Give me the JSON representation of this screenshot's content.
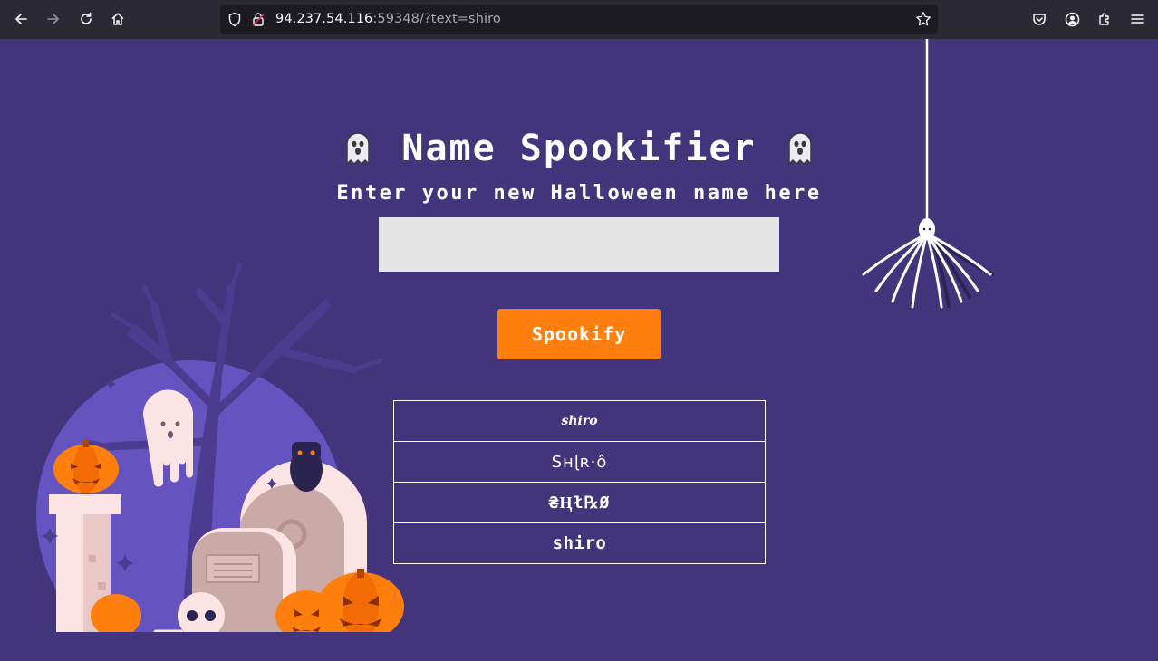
{
  "browser": {
    "url_host": "94.237.54.116",
    "url_rest": ":59348/?text=shiro",
    "icons": [
      "back-arrow-icon",
      "forward-arrow-icon",
      "reload-icon",
      "home-icon",
      "shield-icon",
      "lock-icon",
      "bookmark-star-icon",
      "pocket-icon",
      "account-icon",
      "extensions-icon",
      "menu-icon"
    ]
  },
  "page": {
    "title": "Name Spookifier",
    "subtitle": "Enter your new Halloween name here",
    "input_value": "",
    "button_label": "Spookify",
    "results": [
      "shiro",
      "Sʜɭʀ·ô",
      "₴Ⱨł℞Ø",
      "shiro"
    ]
  },
  "colors": {
    "background": "#43357c",
    "button": "#ff7f0e",
    "input": "#e5e5e5",
    "toolbar": "#2b2a33"
  }
}
